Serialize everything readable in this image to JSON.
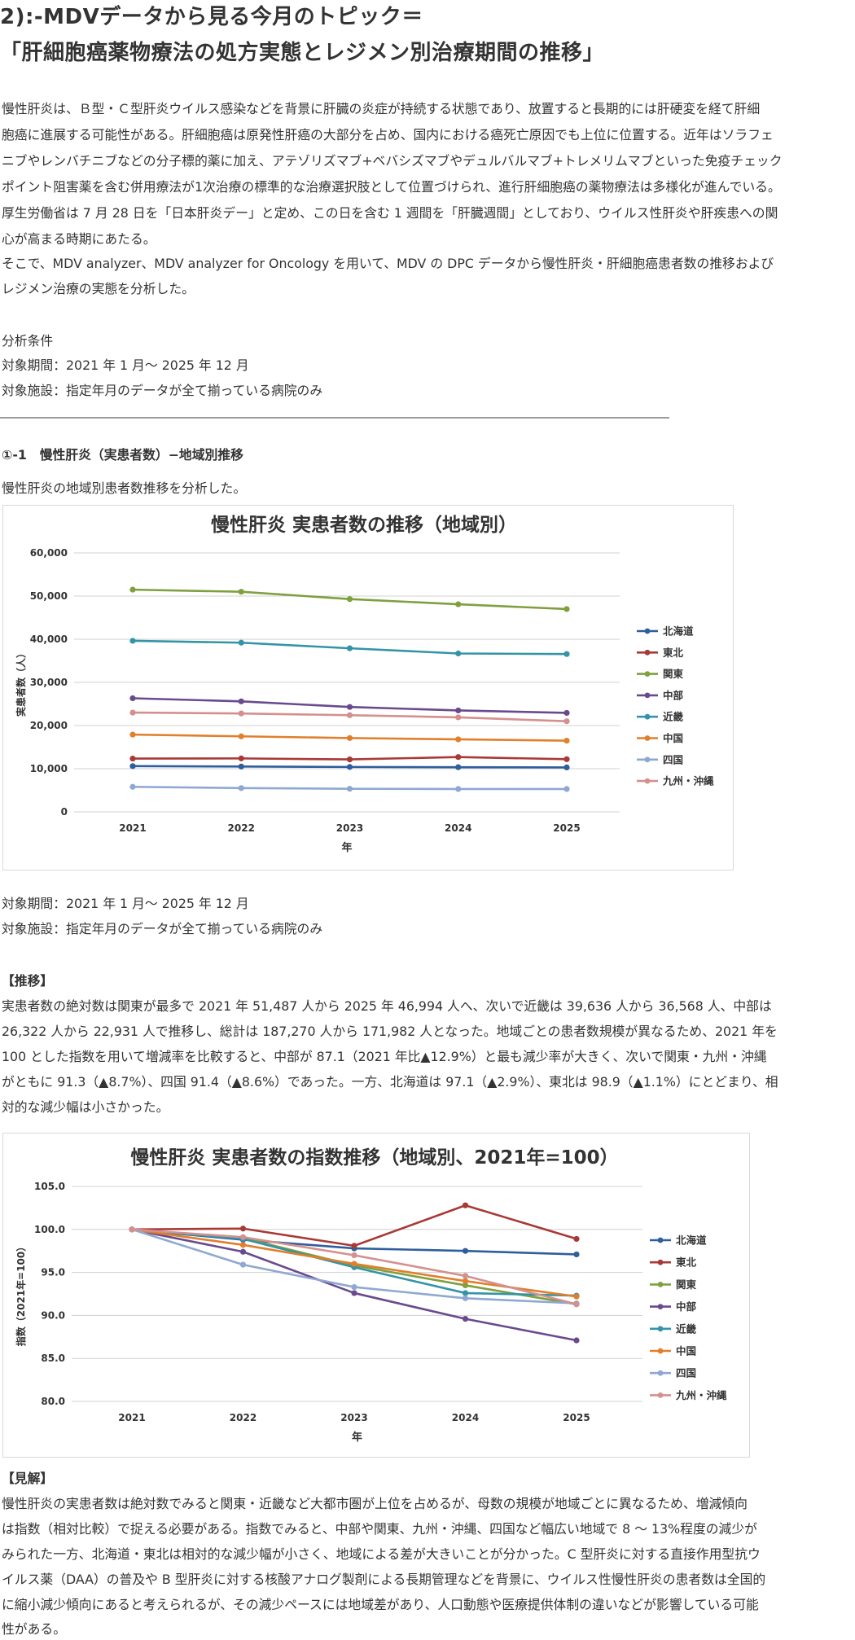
{
  "title_line1": "2):-MDVデータから見る今月のトピック＝",
  "title_line2": "「肝細胞癌薬物療法の処方実態とレジメン別治療期間の推移」",
  "intro": [
    "慢性肝炎は、Ｂ型・Ｃ型肝炎ウイルス感染などを背景に肝臓の炎症が持続する状態であり、放置すると長期的には肝硬変を経て肝細",
    "胞癌に進展する可能性がある。肝細胞癌は原発性肝癌の大部分を占め、国内における癌死亡原因でも上位に位置する。近年はソラフェ",
    "ニブやレンバチニブなどの分子標的薬に加え、アテゾリズマブ+ベバシズマブやデュルバルマブ+トレメリムマブといった免疫チェック",
    "ポイント阻害薬を含む併用療法が1次治療の標準的な治療選択肢として位置づけられ、進行肝細胞癌の薬物療法は多様化が進んでいる。",
    "厚生労働省は 7 月 28 日を「日本肝炎デー」と定め、この日を含む 1 週間を「肝臓週間」としており、ウイルス性肝炎や肝疾患への関",
    "心が高まる時期にあたる。",
    "そこで、MDV analyzer、MDV analyzer for Oncology を用いて、MDV の DPC データから慢性肝炎・肝細胞癌患者数の推移および",
    "レジメン治療の実態を分析した。"
  ],
  "conditions": {
    "heading": "分析条件",
    "period": "対象期間：2021 年 1 月～ 2025 年 12 月",
    "facility": "対象施設：指定年月のデータが全て揃っている病院のみ"
  },
  "section1": {
    "heading": "①-1　慢性肝炎（実患者数）−地域別推移",
    "intro": "慢性肝炎の地域別患者数推移を分析した。"
  },
  "notes": {
    "period": "対象期間：2021 年 1 月～ 2025 年 12 月",
    "facility": "対象施設：指定年月のデータが全て揃っている病院のみ"
  },
  "trend": {
    "heading": "【推移】",
    "lines": [
      "実患者数の絶対数は関東が最多で 2021 年 51,487 人から 2025 年 46,994 人へ、次いで近畿は 39,636 人から 36,568 人、中部は",
      "26,322 人から 22,931 人で推移し、総計は 187,270 人から 171,982 人となった。地域ごとの患者数規模が異なるため、2021 年を",
      "100 とした指数を用いて増減率を比較すると、中部が 87.1（2021 年比▲12.9%）と最も減少率が大きく、次いで関東・九州・沖縄",
      "がともに 91.3（▲8.7%）、四国 91.4（▲8.6%）であった。一方、北海道は 97.1（▲2.9%）、東北は 98.9（▲1.1%）にとどまり、相",
      "対的な減少幅は小さかった。"
    ]
  },
  "insight": {
    "heading": "【見解】",
    "lines": [
      "慢性肝炎の実患者数は絶対数でみると関東・近畿など大都市圏が上位を占めるが、母数の規模が地域ごとに異なるため、増減傾向",
      "は指数（相対比較）で捉える必要がある。指数でみると、中部や関東、九州・沖縄、四国など幅広い地域で 8 ～ 13%程度の減少が",
      "みられた一方、北海道・東北は相対的な減少幅が小さく、地域による差が大きいことが分かった。C 型肝炎に対する直接作用型抗ウ",
      "イルス薬（DAA）の普及や B 型肝炎に対する核酸アナログ製剤による長期管理などを背景に、ウイルス性慢性肝炎の患者数は全国的",
      "に縮小減少傾向にあると考えられるが、その減少ペースには地域差があり、人口動態や医療提供体制の違いなどが影響している可能",
      "性がある。"
    ]
  },
  "chart_data": [
    {
      "type": "line",
      "title": "慢性肝炎 実患者数の推移（地域別）",
      "xlabel": "年",
      "ylabel": "実患者数（人）",
      "x": [
        "2021",
        "2022",
        "2023",
        "2024",
        "2025"
      ],
      "yticks": [
        "0",
        "10,000",
        "20,000",
        "30,000",
        "40,000",
        "50,000",
        "60,000"
      ],
      "ylim": [
        0,
        60000
      ],
      "grid": true,
      "legend": "right",
      "series": [
        {
          "name": "北海道",
          "color": "#2e5e9c",
          "values": [
            10600,
            10500,
            10400,
            10350,
            10300
          ]
        },
        {
          "name": "東北",
          "color": "#a83a36",
          "values": [
            12350,
            12380,
            12150,
            12700,
            12200
          ]
        },
        {
          "name": "関東",
          "color": "#7fa03e",
          "values": [
            51487,
            51000,
            49300,
            48100,
            46994
          ]
        },
        {
          "name": "中部",
          "color": "#6a4a8e",
          "values": [
            26322,
            25600,
            24300,
            23500,
            22931
          ]
        },
        {
          "name": "近畿",
          "color": "#3494a6",
          "values": [
            39636,
            39200,
            37900,
            36700,
            36568
          ]
        },
        {
          "name": "中国",
          "color": "#e07f2c",
          "values": [
            17900,
            17500,
            17100,
            16800,
            16500
          ]
        },
        {
          "name": "四国",
          "color": "#8fa8d2",
          "values": [
            5800,
            5500,
            5350,
            5300,
            5300
          ]
        },
        {
          "name": "九州・沖縄",
          "color": "#d4908e",
          "values": [
            23000,
            22800,
            22400,
            21900,
            21000
          ]
        }
      ]
    },
    {
      "type": "line",
      "title": "慢性肝炎 実患者数の指数推移（地域別、2021年=100）",
      "xlabel": "年",
      "ylabel": "指数（2021年=100）",
      "x": [
        "2021",
        "2022",
        "2023",
        "2024",
        "2025"
      ],
      "yticks": [
        "80.0",
        "85.0",
        "90.0",
        "95.0",
        "100.0",
        "105.0"
      ],
      "ylim": [
        80,
        105
      ],
      "grid": true,
      "legend": "right",
      "series": [
        {
          "name": "北海道",
          "color": "#2e5e9c",
          "values": [
            100.0,
            98.8,
            97.8,
            97.5,
            97.1
          ]
        },
        {
          "name": "東北",
          "color": "#a83a36",
          "values": [
            100.0,
            100.1,
            98.1,
            102.8,
            98.9
          ]
        },
        {
          "name": "関東",
          "color": "#7fa03e",
          "values": [
            100.0,
            99.0,
            95.8,
            93.5,
            91.3
          ]
        },
        {
          "name": "中部",
          "color": "#6a4a8e",
          "values": [
            100.0,
            97.4,
            92.6,
            89.6,
            87.1
          ]
        },
        {
          "name": "近畿",
          "color": "#3494a6",
          "values": [
            100.0,
            98.9,
            95.6,
            92.6,
            92.3
          ]
        },
        {
          "name": "中国",
          "color": "#e07f2c",
          "values": [
            100.0,
            98.2,
            96.0,
            94.0,
            92.2
          ]
        },
        {
          "name": "四国",
          "color": "#8fa8d2",
          "values": [
            100.0,
            95.9,
            93.3,
            92.0,
            91.4
          ]
        },
        {
          "name": "九州・沖縄",
          "color": "#d4908e",
          "values": [
            100.0,
            99.1,
            97.0,
            94.6,
            91.3
          ]
        }
      ]
    }
  ]
}
